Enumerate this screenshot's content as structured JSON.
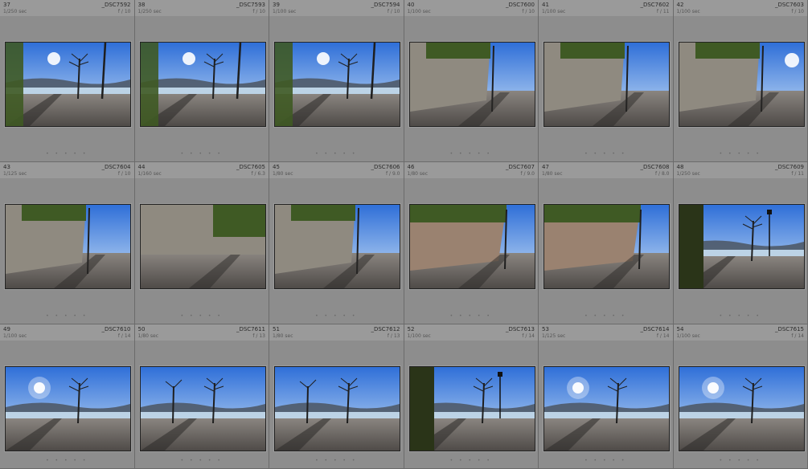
{
  "grid": {
    "dots_glyph": "• • • • •",
    "cells": [
      {
        "index": "37",
        "file": "_DSC7592",
        "shutter": "1/250 sec",
        "aperture": "f / 10",
        "scene": "lake-trees"
      },
      {
        "index": "38",
        "file": "_DSC7593",
        "shutter": "1/250 sec",
        "aperture": "f / 10",
        "scene": "lake-trees"
      },
      {
        "index": "39",
        "file": "_DSC7594",
        "shutter": "1/100 sec",
        "aperture": "f / 10",
        "scene": "lake-trees"
      },
      {
        "index": "40",
        "file": "_DSC7600",
        "shutter": "1/100 sec",
        "aperture": "f / 10",
        "scene": "wall-tree"
      },
      {
        "index": "41",
        "file": "_DSC7602",
        "shutter": "1/100 sec",
        "aperture": "f / 11",
        "scene": "wall-tree"
      },
      {
        "index": "42",
        "file": "_DSC7603",
        "shutter": "1/100 sec",
        "aperture": "f / 10",
        "scene": "wall-sun"
      },
      {
        "index": "43",
        "file": "_DSC7604",
        "shutter": "1/125 sec",
        "aperture": "f / 10",
        "scene": "wall-tree"
      },
      {
        "index": "44",
        "file": "_DSC7605",
        "shutter": "1/160 sec",
        "aperture": "f / 6.3",
        "scene": "wall-only"
      },
      {
        "index": "45",
        "file": "_DSC7606",
        "shutter": "1/80 sec",
        "aperture": "f / 9.0",
        "scene": "wall-tree"
      },
      {
        "index": "46",
        "file": "_DSC7607",
        "shutter": "1/80 sec",
        "aperture": "f / 9.0",
        "scene": "rock-tree"
      },
      {
        "index": "47",
        "file": "_DSC7608",
        "shutter": "1/80 sec",
        "aperture": "f / 8.0",
        "scene": "rock-tree"
      },
      {
        "index": "48",
        "file": "_DSC7609",
        "shutter": "1/250 sec",
        "aperture": "f / 11",
        "scene": "lake-lamp"
      },
      {
        "index": "49",
        "file": "_DSC7610",
        "shutter": "1/100 sec",
        "aperture": "f / 14",
        "scene": "lake-sun"
      },
      {
        "index": "50",
        "file": "_DSC7611",
        "shutter": "1/80 sec",
        "aperture": "f / 13",
        "scene": "lake-open"
      },
      {
        "index": "51",
        "file": "_DSC7612",
        "shutter": "1/80 sec",
        "aperture": "f / 13",
        "scene": "lake-open"
      },
      {
        "index": "52",
        "file": "_DSC7613",
        "shutter": "1/100 sec",
        "aperture": "f / 14",
        "scene": "lake-lamp"
      },
      {
        "index": "53",
        "file": "_DSC7614",
        "shutter": "1/125 sec",
        "aperture": "f / 14",
        "scene": "lake-sun"
      },
      {
        "index": "54",
        "file": "_DSC7615",
        "shutter": "1/100 sec",
        "aperture": "f / 14",
        "scene": "lake-sun"
      }
    ]
  },
  "colors": {
    "sky_top": "#2f6fd8",
    "sky_bottom": "#cfe4f7",
    "wall": "#8f8a80",
    "ground": "#6e6a66",
    "foliage": "#3f5a24",
    "mountains": "#4b5560"
  }
}
